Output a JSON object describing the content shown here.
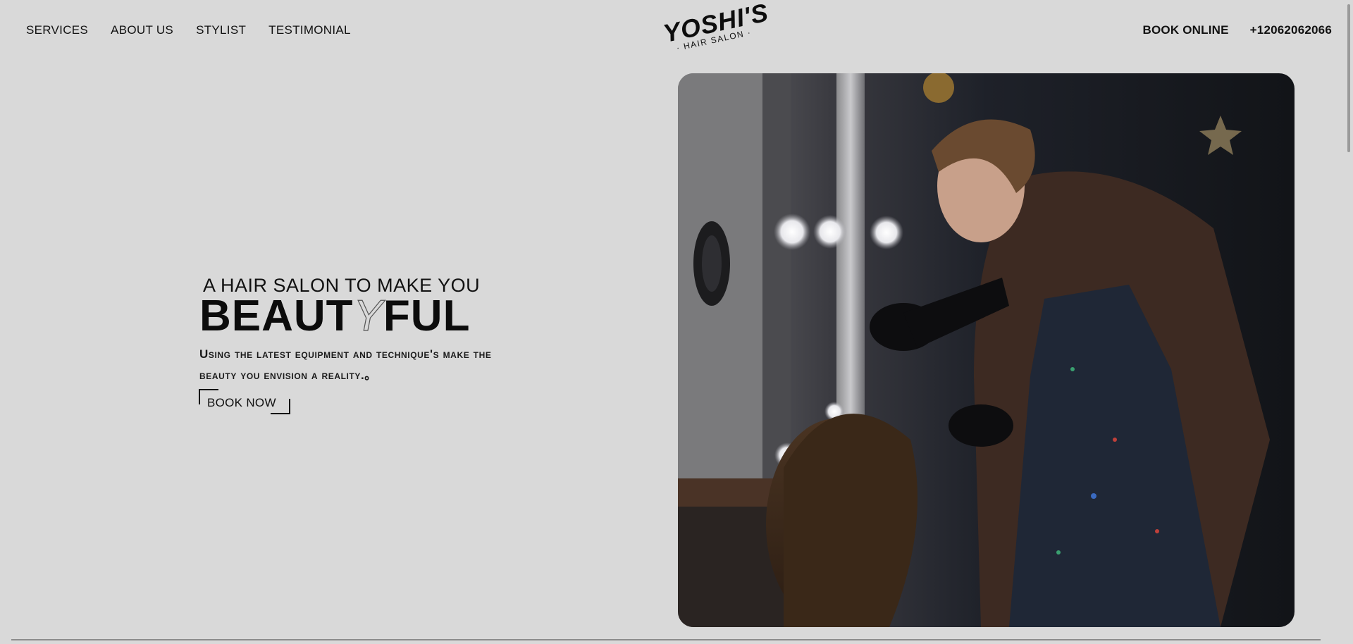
{
  "nav": {
    "left": [
      "SERVICES",
      "ABOUT US",
      "STYLIST",
      "TESTIMONIAL"
    ],
    "book_online": "BOOK ONLINE",
    "phone": "+12062062066"
  },
  "logo": {
    "name": "YOSHI'S",
    "sub": "· HAIR SALON ·"
  },
  "hero": {
    "tagline": "A HAIR SALON TO MAKE YOU",
    "headline_part1": "BEAUT",
    "headline_outline": "Y",
    "headline_part2": "FUL",
    "description": "Using the latest equipment and technique's make the beauty you envision a reality.。",
    "cta": "BOOK NOW"
  },
  "colors": {
    "background": "#d9d9d9",
    "text": "#111111"
  }
}
